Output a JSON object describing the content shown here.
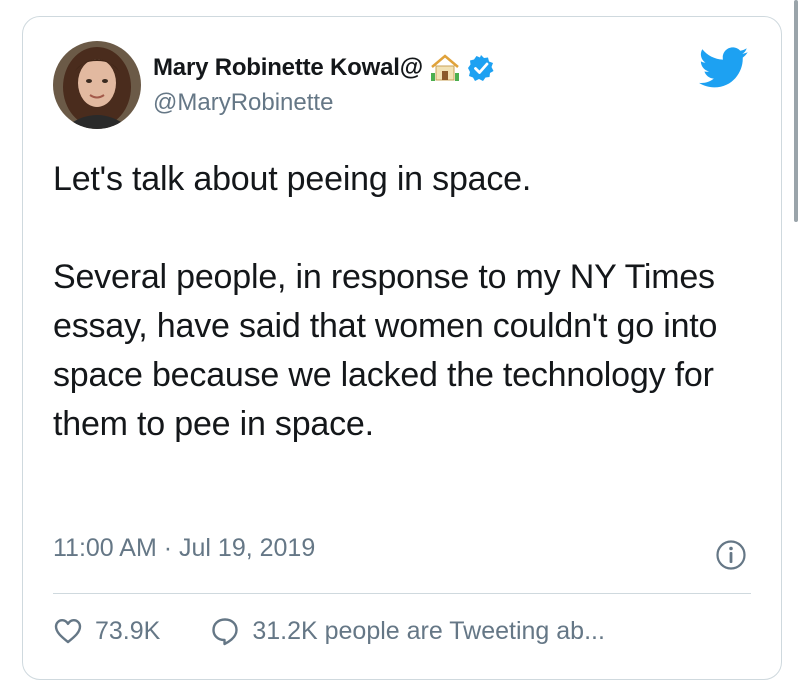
{
  "tweet": {
    "display_name": "Mary Robinette Kowal@",
    "handle": "@MaryRobinette",
    "text": "Let's talk about peeing in space.\n\nSeveral people, in response to my NY Times essay, have said that women couldn't go into space because we lacked the technology for them to pee in space.",
    "time": "11:00 AM",
    "separator": "·",
    "date": "Jul 19, 2019",
    "likes": "73.9K",
    "tweeting_text": "31.2K people are Tweeting ab..."
  },
  "icons": {
    "brand": "twitter-bird-icon",
    "verified": "verified-badge-icon",
    "emoji": "house-emoji-icon",
    "info": "info-icon",
    "like": "heart-icon",
    "reply": "speech-bubble-icon"
  },
  "colors": {
    "accent": "#1da1f2",
    "text": "#14171a",
    "muted": "#657786",
    "border": "#cfd9de"
  }
}
